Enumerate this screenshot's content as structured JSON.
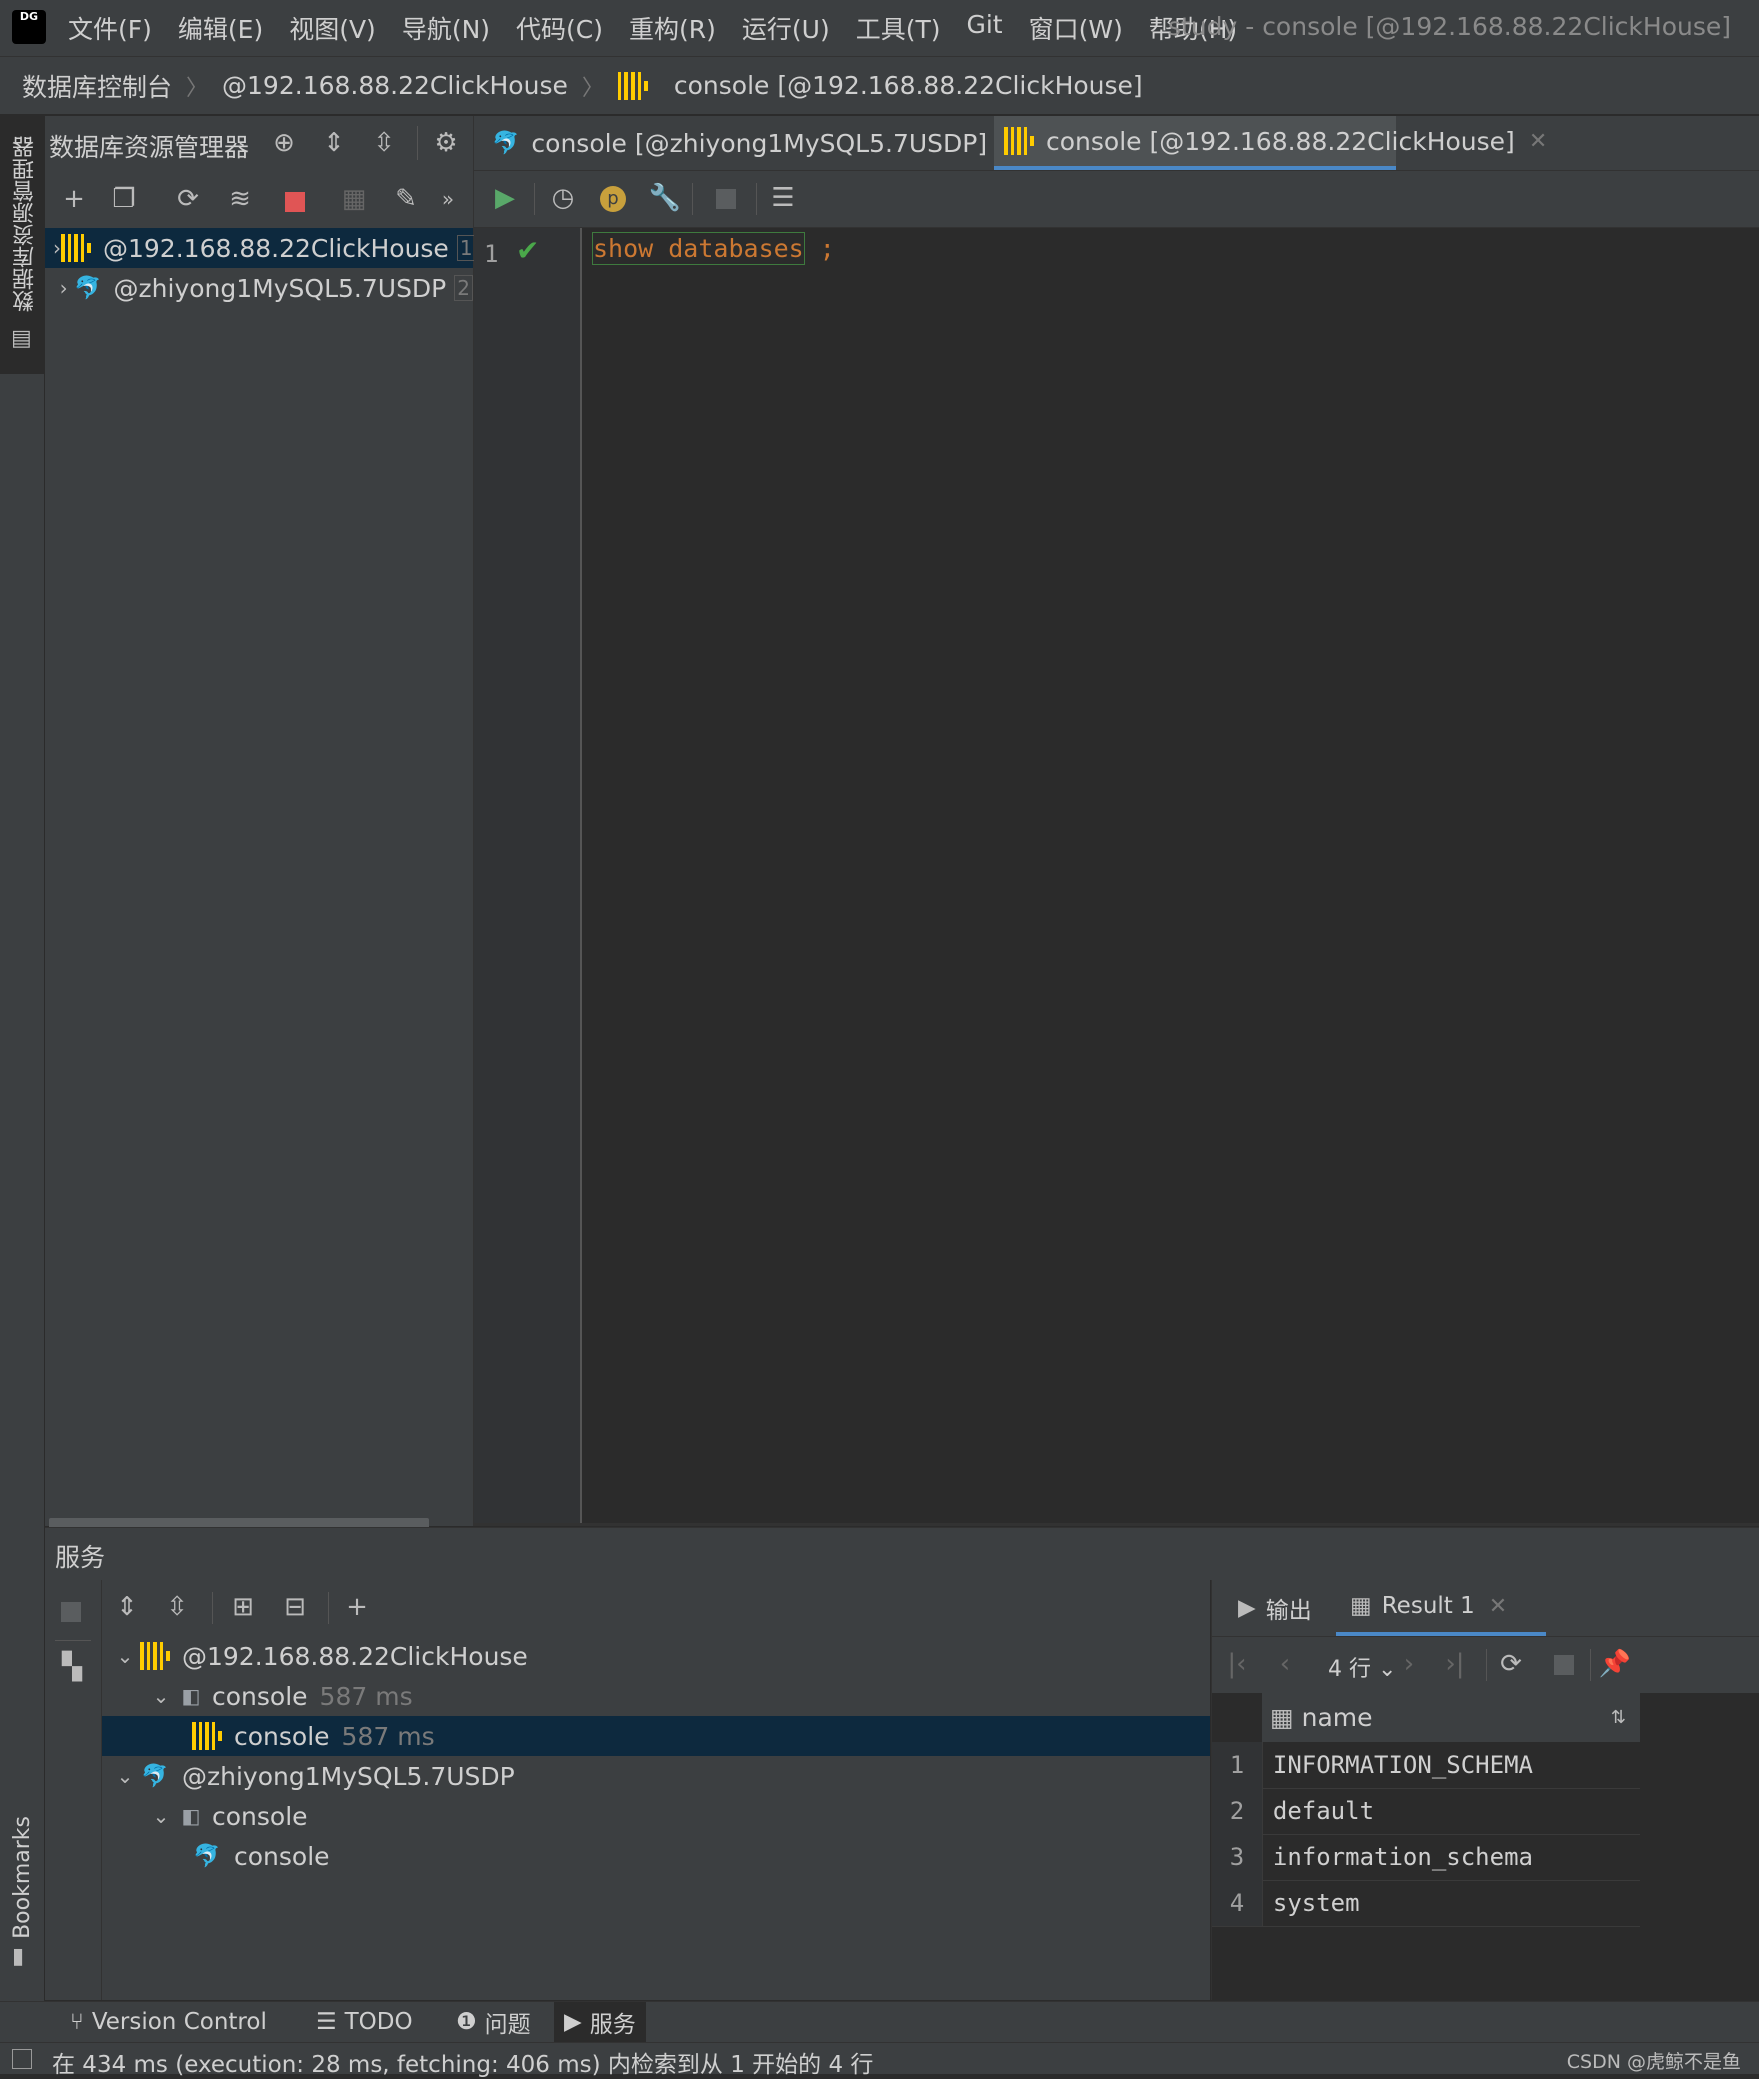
{
  "menubar": {
    "logo_text": "DG",
    "items": [
      "文件(F)",
      "编辑(E)",
      "视图(V)",
      "导航(N)",
      "代码(C)",
      "重构(R)",
      "运行(U)",
      "工具(T)",
      "Git",
      "窗口(W)",
      "帮助(H)"
    ],
    "window_title": "study - console [@192.168.88.22ClickHouse]"
  },
  "breadcrumb": {
    "items": [
      "数据库控制台",
      "@192.168.88.22ClickHouse",
      "console [@192.168.88.22ClickHouse]"
    ]
  },
  "left_stripe": {
    "db_tab_label": "数据库资源管理器",
    "bookmarks_label": "Bookmarks"
  },
  "db_explorer": {
    "title": "数据库资源管理器",
    "tree": [
      {
        "label": "@192.168.88.22ClickHouse",
        "count": "1",
        "type": "clickhouse",
        "selected": true
      },
      {
        "label": "@zhiyong1MySQL5.7USDP",
        "count": "2",
        "type": "mysql",
        "selected": false
      }
    ]
  },
  "editor": {
    "tabs": [
      {
        "label": "console [@zhiyong1MySQL5.7USDP]",
        "type": "mysql",
        "active": false
      },
      {
        "label": "console [@192.168.88.22ClickHouse]",
        "type": "clickhouse",
        "active": true
      }
    ],
    "line_number": "1",
    "code_keyword": "show databases",
    "code_rest": " ;"
  },
  "services": {
    "title": "服务",
    "tree": [
      {
        "label": "@192.168.88.22ClickHouse",
        "time": "",
        "type": "clickhouse"
      },
      {
        "label": "console",
        "time": "587 ms",
        "type": "console"
      },
      {
        "label": "console",
        "time": "587 ms",
        "type": "clickhouse"
      },
      {
        "label": "@zhiyong1MySQL5.7USDP",
        "time": "",
        "type": "mysql"
      },
      {
        "label": "console",
        "time": "",
        "type": "console"
      },
      {
        "label": "console",
        "time": "",
        "type": "mysql"
      }
    ]
  },
  "results": {
    "tab_output": "输出",
    "tab_result": "Result 1",
    "rows_label": "4 行",
    "column_header": "name",
    "rows": [
      "INFORMATION_SCHEMA",
      "default",
      "information_schema",
      "system"
    ]
  },
  "tool_tabs": [
    "Version Control",
    "TODO",
    "问题",
    "服务"
  ],
  "status_text": "在 434 ms (execution: 28 ms, fetching: 406 ms) 内检索到从 1 开始的 4 行",
  "watermark": "CSDN @虎鲸不是鱼",
  "colors": {
    "accent": "#4a88c7",
    "clickhouse": "#ffcc00",
    "mysql": "#4a9ed8",
    "keyword": "#cc7832",
    "run": "#59a869",
    "stop": "#e05555"
  }
}
